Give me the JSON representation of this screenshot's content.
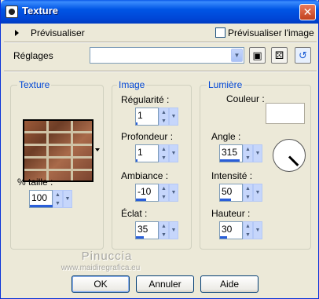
{
  "window": {
    "title": "Texture"
  },
  "preview": {
    "label": "Prévisualiser",
    "checkbox_label": "Prévisualiser l'image",
    "checked": false
  },
  "settings": {
    "label": "Réglages",
    "combo_value": ""
  },
  "groups": {
    "texture": {
      "title": "Texture",
      "size_label": "% taille :",
      "size_value": "100"
    },
    "image": {
      "title": "Image",
      "regularity_label": "Régularité :",
      "regularity_value": "1",
      "depth_label": "Profondeur :",
      "depth_value": "1",
      "ambience_label": "Ambiance :",
      "ambience_value": "-10",
      "shine_label": "Éclat :",
      "shine_value": "35"
    },
    "light": {
      "title": "Lumière",
      "color_label": "Couleur :",
      "color_value": "#ffffff",
      "angle_label": "Angle :",
      "angle_value": "315",
      "intensity_label": "Intensité :",
      "intensity_value": "50",
      "height_label": "Hauteur :",
      "height_value": "30"
    }
  },
  "watermark": {
    "name": "Pinuccia",
    "site": "www.maidiregrafica.eu"
  },
  "buttons": {
    "ok": "OK",
    "cancel": "Annuler",
    "help": "Aide"
  },
  "icons": [
    "app-icon",
    "close-icon",
    "expand-triangle-icon",
    "save-icon",
    "random-dice-icon",
    "reset-icon",
    "angle-dial-icon"
  ]
}
